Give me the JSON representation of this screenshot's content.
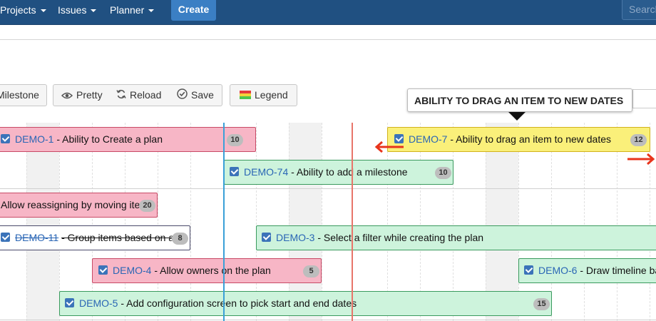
{
  "nav": {
    "items": [
      {
        "label": "Projects"
      },
      {
        "label": "Issues"
      },
      {
        "label": "Planner"
      }
    ],
    "create_label": "Create",
    "search_placeholder": "Search"
  },
  "toolbar": {
    "milestone_label": "Milestone",
    "pretty_label": "Pretty",
    "reload_label": "Reload",
    "save_label": "Save",
    "legend_label": "Legend"
  },
  "tooltip": {
    "text": "ABILITY TO DRAG AN ITEM TO NEW DATES"
  },
  "timeline": {
    "items": [
      {
        "key": "DEMO-1",
        "title": "- Ability to Create a plan",
        "badge": "10",
        "color": "pink"
      },
      {
        "key": "DEMO-7",
        "title": "- Ability to drag an item to new dates",
        "badge": "12",
        "color": "yellow"
      },
      {
        "key": "DEMO-74",
        "title": "- Ability to add a milestone",
        "badge": "10",
        "color": "green"
      },
      {
        "key": "",
        "title": "Allow reassigning by moving ite",
        "badge": "20",
        "color": "pink"
      },
      {
        "key": "DEMO-11",
        "title": "- Group items based on a",
        "badge": "8",
        "color": "white"
      },
      {
        "key": "DEMO-3",
        "title": "- Select a filter while creating the plan",
        "badge": "",
        "color": "green"
      },
      {
        "key": "DEMO-4",
        "title": "- Allow owners on the plan",
        "badge": "5",
        "color": "pink"
      },
      {
        "key": "DEMO-6",
        "title": "- Draw timeline ba",
        "badge": "",
        "color": "green"
      },
      {
        "key": "DEMO-5",
        "title": "- Add configuration screen to pick start and end dates",
        "badge": "15",
        "color": "green"
      }
    ]
  },
  "colors": {
    "nav_bg": "#205081",
    "create_bg": "#3b7fc4",
    "today_line": "#3aa0d8",
    "deadline_line": "#e8756a",
    "drag_arrow": "#e8341c"
  },
  "icons": [
    "eye-icon",
    "reload-icon",
    "check-circle-icon",
    "legend-swatch-icon",
    "checkbox-icon",
    "drag-left-arrow-icon",
    "drag-right-arrow-icon"
  ]
}
